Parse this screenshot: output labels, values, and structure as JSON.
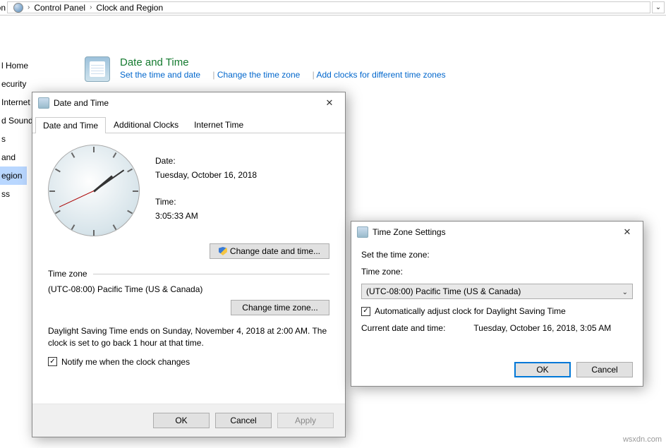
{
  "breadcrumb": {
    "seg1": "Control Panel",
    "seg2": "Clock and Region",
    "truncated_title": "on"
  },
  "sidebar": {
    "items": [
      "l Home",
      "ecurity",
      "Internet",
      "d Sound",
      "s",
      "and",
      "egion",
      "ss"
    ],
    "current_index": 6
  },
  "cp": {
    "title": "Date and Time",
    "links": [
      "Set the time and date",
      "Change the time zone",
      "Add clocks for different time zones"
    ]
  },
  "dt_dialog": {
    "title": "Date and Time",
    "tabs": [
      "Date and Time",
      "Additional Clocks",
      "Internet Time"
    ],
    "active_tab": 0,
    "date_label": "Date:",
    "date_value": "Tuesday, October 16, 2018",
    "time_label": "Time:",
    "time_value": "3:05:33 AM",
    "change_btn": "Change date and time...",
    "tz_section": "Time zone",
    "tz_value": "(UTC-08:00) Pacific Time (US & Canada)",
    "change_tz_btn": "Change time zone...",
    "dst_note": "Daylight Saving Time ends on Sunday, November 4, 2018 at 2:00 AM. The clock is set to go back 1 hour at that time.",
    "notify_label": "Notify me when the clock changes",
    "notify_checked": true,
    "footer": {
      "ok": "OK",
      "cancel": "Cancel",
      "apply": "Apply"
    }
  },
  "tz_dialog": {
    "title": "Time Zone Settings",
    "heading": "Set the time zone:",
    "tz_label": "Time zone:",
    "tz_value": "(UTC-08:00) Pacific Time (US & Canada)",
    "dst_label": "Automatically adjust clock for Daylight Saving Time",
    "dst_checked": true,
    "current_label": "Current date and time:",
    "current_value": "Tuesday, October 16, 2018, 3:05 AM",
    "ok": "OK",
    "cancel": "Cancel"
  },
  "watermark": "wsxdn.com"
}
